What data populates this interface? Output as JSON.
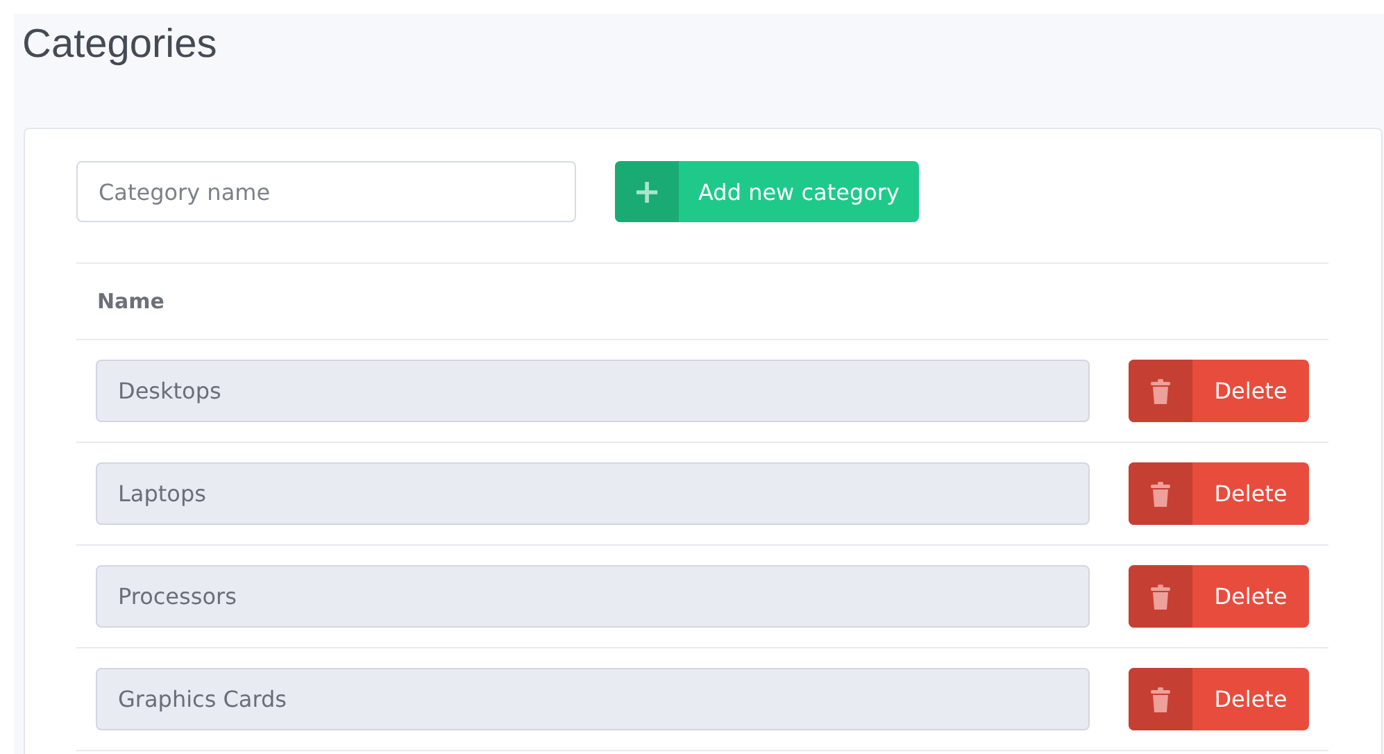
{
  "page": {
    "title": "Categories"
  },
  "new_category": {
    "placeholder": "Category name",
    "button": {
      "icon": "+",
      "label": "Add new category"
    }
  },
  "table": {
    "columns": [
      "Name"
    ],
    "rows": [
      {
        "name": "Desktops",
        "action": "Delete"
      },
      {
        "name": "Laptops",
        "action": "Delete"
      },
      {
        "name": "Processors",
        "action": "Delete"
      },
      {
        "name": "Graphics Cards",
        "action": "Delete"
      }
    ]
  }
}
